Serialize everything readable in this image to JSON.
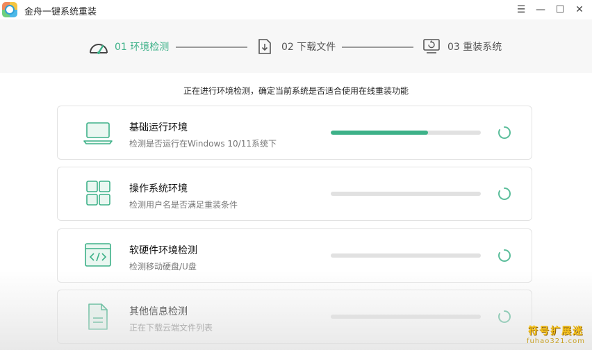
{
  "window": {
    "title": "金舟一键系统重装",
    "controls": {
      "menu": "☰",
      "minimize": "—",
      "maximize": "☐",
      "close": "✕"
    }
  },
  "steps": [
    {
      "label": "01 环境检测",
      "icon": "speedometer-icon",
      "active": true
    },
    {
      "label": "02 下载文件",
      "icon": "download-file-icon",
      "active": false
    },
    {
      "label": "03 重装系统",
      "icon": "monitor-restore-icon",
      "active": false
    }
  ],
  "subtitle": "正在进行环境检测，确定当前系统是否适合使用在线重装功能",
  "checks": [
    {
      "title": "基础运行环境",
      "desc": "检测是否运行在Windows 10/11系统下",
      "progress": 0.65,
      "icon": "laptop-icon"
    },
    {
      "title": "操作系统环境",
      "desc": "检测用户名是否满足重装条件",
      "progress": 0,
      "icon": "grid-icon"
    },
    {
      "title": "软硬件环境检测",
      "desc": "检测移动硬盘/U盘",
      "progress": 0,
      "icon": "code-window-icon"
    },
    {
      "title": "其他信息检测",
      "desc": "正在下载云端文件列表",
      "progress": 0,
      "icon": "document-icon"
    }
  ],
  "colors": {
    "accent": "#3db188",
    "track": "#e1e1e1"
  },
  "watermark": {
    "top": "符号扩展迷",
    "bottom": "fuhao321.com"
  }
}
